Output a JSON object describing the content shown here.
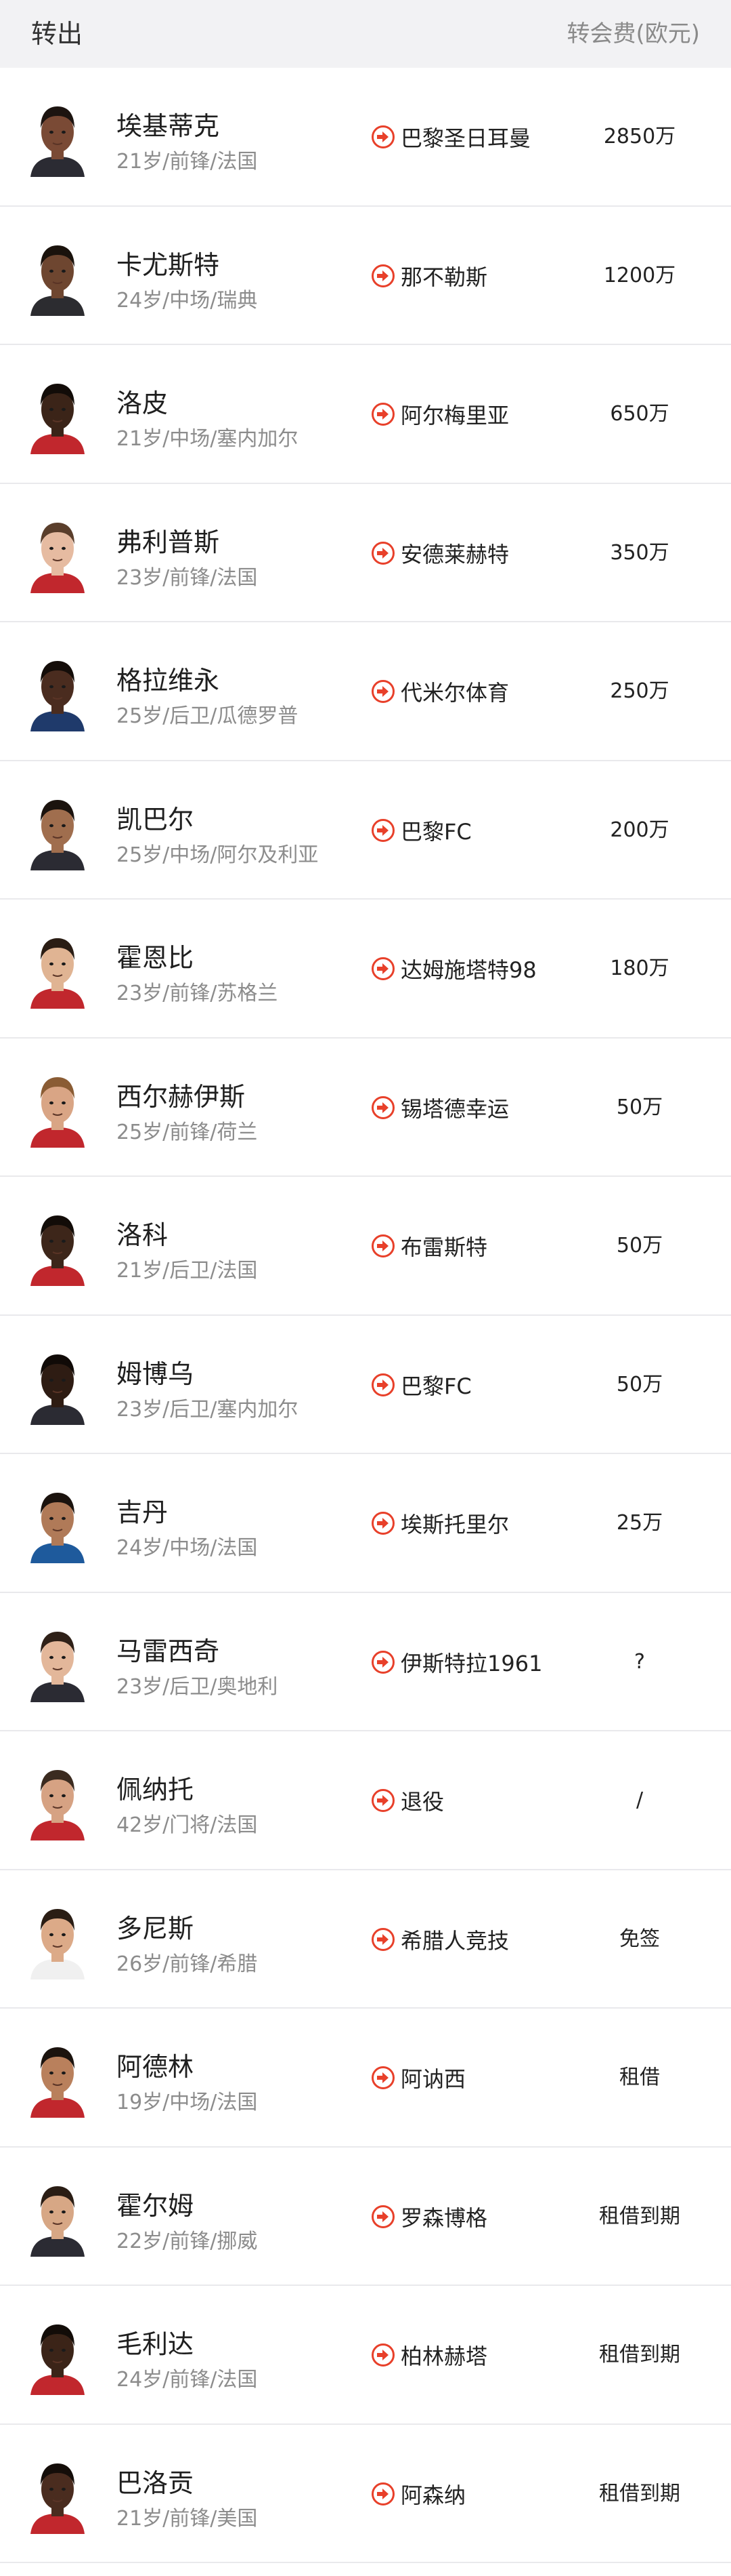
{
  "header": {
    "title": "转出",
    "fee_label": "转会费(欧元)"
  },
  "colors": {
    "arrow": "#e8402a",
    "header_bg": "#f2f2f4",
    "divider": "#e9e9ec"
  },
  "players": [
    {
      "name": "埃基蒂克",
      "info": "21岁/前锋/法国",
      "club": "巴黎圣日耳曼",
      "fee": "2850万",
      "skin": "#7a4a35",
      "hair": "#1c1410",
      "shirt": "#2b2b33"
    },
    {
      "name": "卡尤斯特",
      "info": "24岁/中场/瑞典",
      "club": "那不勒斯",
      "fee": "1200万",
      "skin": "#6e4630",
      "hair": "#1a120c",
      "shirt": "#2c2c30"
    },
    {
      "name": "洛皮",
      "info": "21岁/中场/塞内加尔",
      "club": "阿尔梅里亚",
      "fee": "650万",
      "skin": "#3b2418",
      "hair": "#120c08",
      "shirt": "#c1272d"
    },
    {
      "name": "弗利普斯",
      "info": "23岁/前锋/法国",
      "club": "安德莱赫特",
      "fee": "350万",
      "skin": "#e6bba1",
      "hair": "#5a3e2b",
      "shirt": "#c1272d"
    },
    {
      "name": "格拉维永",
      "info": "25岁/后卫/瓜德罗普",
      "club": "代米尔体育",
      "fee": "250万",
      "skin": "#4a2c1f",
      "hair": "#140d09",
      "shirt": "#1f3a6b"
    },
    {
      "name": "凯巴尔",
      "info": "25岁/中场/阿尔及利亚",
      "club": "巴黎FC",
      "fee": "200万",
      "skin": "#a06e4e",
      "hair": "#1b130e",
      "shirt": "#2b2b33"
    },
    {
      "name": "霍恩比",
      "info": "23岁/前锋/苏格兰",
      "club": "达姆施塔特98",
      "fee": "180万",
      "skin": "#e0b493",
      "hair": "#2a1d14",
      "shirt": "#c1272d"
    },
    {
      "name": "西尔赫伊斯",
      "info": "25岁/前锋/荷兰",
      "club": "锡塔德幸运",
      "fee": "50万",
      "skin": "#d9a585",
      "hair": "#8a5c34",
      "shirt": "#c1272d"
    },
    {
      "name": "洛科",
      "info": "21岁/后卫/法国",
      "club": "布雷斯特",
      "fee": "50万",
      "skin": "#3d261a",
      "hair": "#120c08",
      "shirt": "#c1272d"
    },
    {
      "name": "姆博乌",
      "info": "23岁/后卫/塞内加尔",
      "club": "巴黎FC",
      "fee": "50万",
      "skin": "#2e1c13",
      "hair": "#100a07",
      "shirt": "#2b2b33"
    },
    {
      "name": "吉丹",
      "info": "24岁/中场/法国",
      "club": "埃斯托里尔",
      "fee": "25万",
      "skin": "#b07a58",
      "hair": "#1b130e",
      "shirt": "#1e5a9c"
    },
    {
      "name": "马雷西奇",
      "info": "23岁/后卫/奥地利",
      "club": "伊斯特拉1961",
      "fee": "?",
      "skin": "#e3b79a",
      "hair": "#2f2118",
      "shirt": "#2b2b33"
    },
    {
      "name": "佩纳托",
      "info": "42岁/门将/法国",
      "club": "退役",
      "fee": "/",
      "skin": "#d6a283",
      "hair": "#3b2b20",
      "shirt": "#c1272d"
    },
    {
      "name": "多尼斯",
      "info": "26岁/前锋/希腊",
      "club": "希腊人竞技",
      "fee": "免签",
      "skin": "#dcaa88",
      "hair": "#2a1d14",
      "shirt": "#f0f0f0"
    },
    {
      "name": "阿德林",
      "info": "19岁/中场/法国",
      "club": "阿讷西",
      "fee": "租借",
      "skin": "#b9805c",
      "hair": "#1b130e",
      "shirt": "#c1272d"
    },
    {
      "name": "霍尔姆",
      "info": "22岁/前锋/挪威",
      "club": "罗森博格",
      "fee": "租借到期",
      "skin": "#d7a785",
      "hair": "#2a1d14",
      "shirt": "#2b2b33"
    },
    {
      "name": "毛利达",
      "info": "24岁/前锋/法国",
      "club": "柏林赫塔",
      "fee": "租借到期",
      "skin": "#3b2418",
      "hair": "#120c08",
      "shirt": "#c1272d"
    },
    {
      "name": "巴洛贡",
      "info": "21岁/前锋/美国",
      "club": "阿森纳",
      "fee": "租借到期",
      "skin": "#4a2c1f",
      "hair": "#140d09",
      "shirt": "#c1272d"
    }
  ]
}
